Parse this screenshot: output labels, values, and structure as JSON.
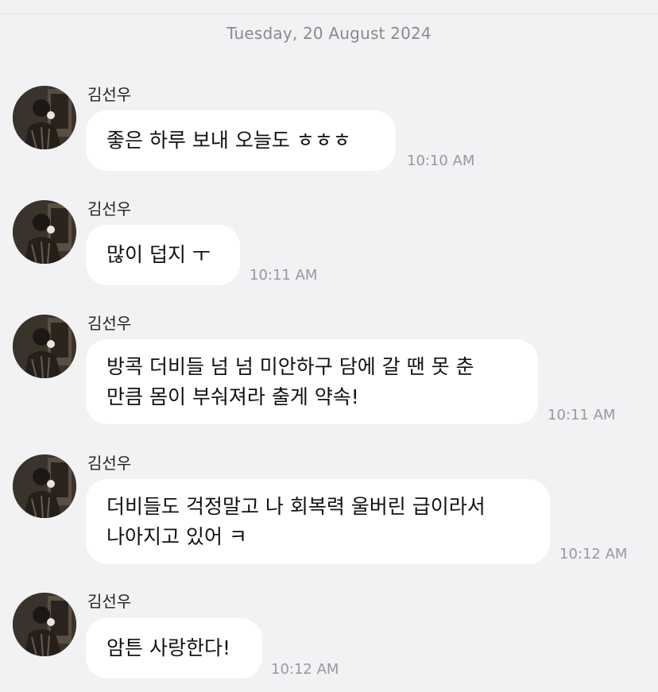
{
  "conversation": {
    "date_header": "Tuesday, 20 August 2024"
  },
  "messages": [
    {
      "sender": "김선우",
      "text": "좋은 하루 보내 오늘도 ㅎㅎㅎ",
      "time": "10:10 AM"
    },
    {
      "sender": "김선우",
      "text": "많이 덥지 ㅜ",
      "time": "10:11 AM"
    },
    {
      "sender": "김선우",
      "text": "방콕 더비들 넘 넘 미안하구 담에 갈 땐 못 춘\n만큼 몸이 부숴져라 출게 약속!",
      "time": "10:11 AM"
    },
    {
      "sender": "김선우",
      "text": "더비들도 걱정말고 나 회복력 울버린 급이라서\n나아지고 있어 ㅋ",
      "time": "10:12 AM"
    },
    {
      "sender": "김선우",
      "text": "암튼 사랑한다!",
      "time": "10:12 AM"
    }
  ],
  "colors": {
    "background": "#f2f2f4",
    "bubble": "#ffffff",
    "timestamp": "#98989d",
    "date_header": "#8a8a8e"
  }
}
